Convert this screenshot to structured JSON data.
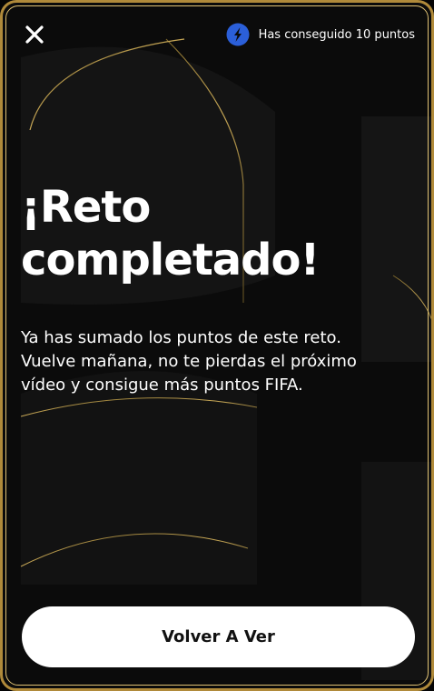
{
  "header": {
    "close_icon": "close-icon",
    "points_icon": "points-logo-icon",
    "points_text": "Has conseguido 10 puntos"
  },
  "main": {
    "title_line1": "¡Reto",
    "title_line2": "completado!",
    "description_line1": "Ya has sumado los puntos de este reto.",
    "description_line2": "Vuelve mañana, no te pierdas el próximo",
    "description_line3": "vídeo y consigue más puntos FIFA."
  },
  "footer": {
    "replay_label": "Volver A Ver"
  },
  "colors": {
    "background": "#0b0b0b",
    "gold_border": "#b08a3a",
    "text": "#ffffff",
    "button_bg": "#ffffff",
    "button_text": "#111111",
    "points_icon_blue": "#2b5fd9"
  }
}
